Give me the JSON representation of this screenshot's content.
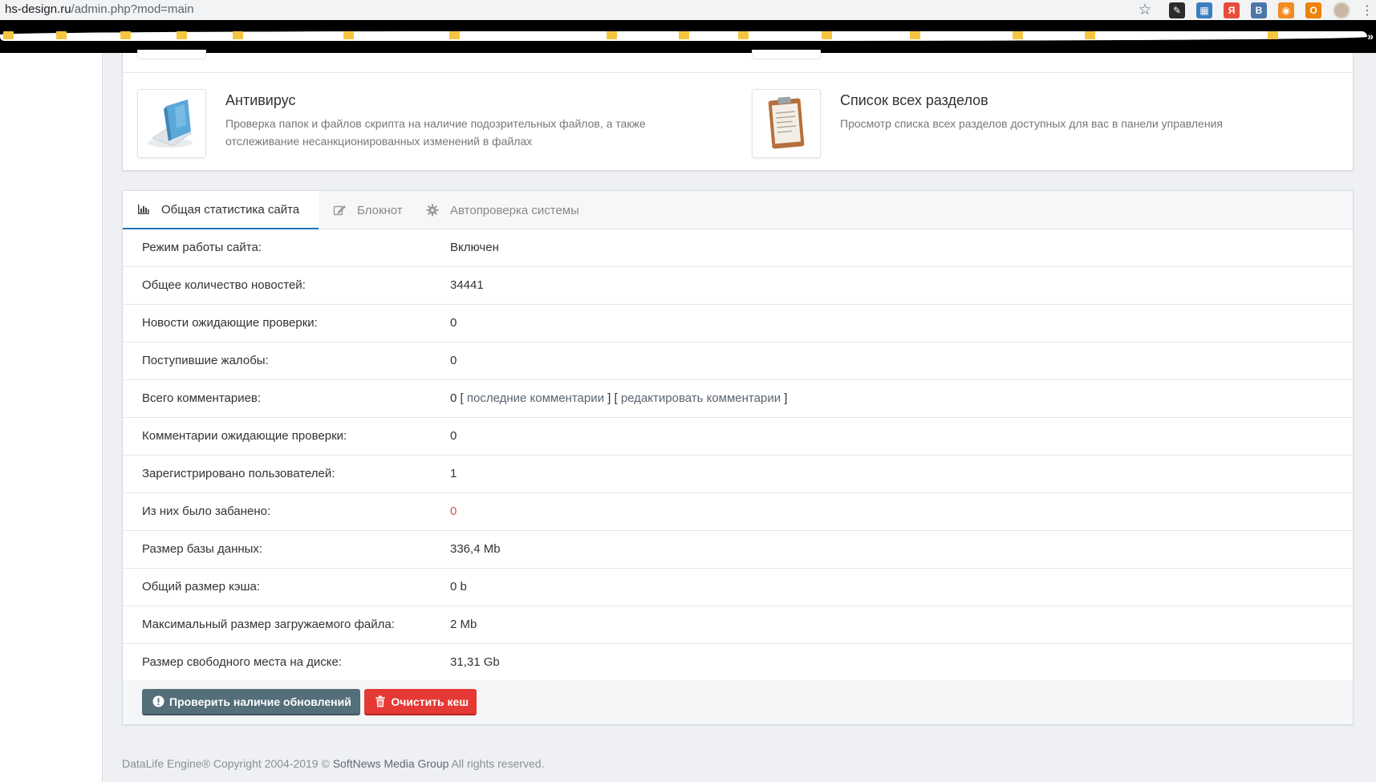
{
  "browser": {
    "url_host": "hs-design.ru",
    "url_path": "/admin.php?mod=main",
    "extensions": [
      {
        "name": "ext-pen",
        "color": "#2b2b2b",
        "glyph": "✎"
      },
      {
        "name": "ext-grid",
        "color": "#3d7ebf",
        "glyph": "▦"
      },
      {
        "name": "ext-yandex",
        "color": "#e84c3d",
        "glyph": "Я"
      },
      {
        "name": "ext-vk",
        "color": "#4a76a8",
        "glyph": "В"
      },
      {
        "name": "ext-rss",
        "color": "#f28b24",
        "glyph": "◉"
      },
      {
        "name": "ext-ok",
        "color": "#ee8208",
        "glyph": "О"
      }
    ],
    "bookmarks_more": "»"
  },
  "quick_items": [
    {
      "title": "Антивирус",
      "description": "Проверка папок и файлов скрипта на наличие подозрительных файлов, а также отслеживание несанкционированных изменений в файлах"
    },
    {
      "title": "Список всех разделов",
      "description": "Просмотр списка всех разделов доступных для вас в панели управления"
    }
  ],
  "tabs": [
    {
      "label": "Общая статистика сайта",
      "active": true,
      "icon": "bar-chart-icon"
    },
    {
      "label": "Блокнот",
      "active": false,
      "icon": "edit-icon"
    },
    {
      "label": "Автопроверка системы",
      "active": false,
      "icon": "gear-icon"
    }
  ],
  "stats": [
    {
      "label": "Режим работы сайта:",
      "value": "Включен"
    },
    {
      "label": "Общее количество новостей:",
      "value": "34441"
    },
    {
      "label": "Новости ожидающие проверки:",
      "value": "0"
    },
    {
      "label": "Поступившие жалобы:",
      "value": "0"
    },
    {
      "label": "Всего комментариев:",
      "value": "0",
      "link1": "последние комментарии",
      "link2": "редактировать комментарии"
    },
    {
      "label": "Комментарии ожидающие проверки:",
      "value": "0"
    },
    {
      "label": "Зарегистрировано пользователей:",
      "value": "1"
    },
    {
      "label": "Из них было забанено:",
      "value": "0",
      "status_color": "#d9534f"
    },
    {
      "label": "Размер базы данных:",
      "value": "336,4 Mb"
    },
    {
      "label": "Общий размер кэша:",
      "value": "0 b"
    },
    {
      "label": "Максимальный размер загружаемого файла:",
      "value": "2 Mb"
    },
    {
      "label": "Размер свободного места на диске:",
      "value": "31,31 Gb"
    }
  ],
  "buttons": {
    "check_updates": "Проверить наличие обновлений",
    "clear_cache": "Очистить кеш"
  },
  "footer": {
    "prefix": "DataLife Engine® Copyright 2004-2019 ©",
    "company": "SoftNews Media Group",
    "suffix": "All rights reserved."
  },
  "colors": {
    "accent": "#1e73be",
    "button_dark": "#546e7a",
    "button_red": "#e53935"
  }
}
